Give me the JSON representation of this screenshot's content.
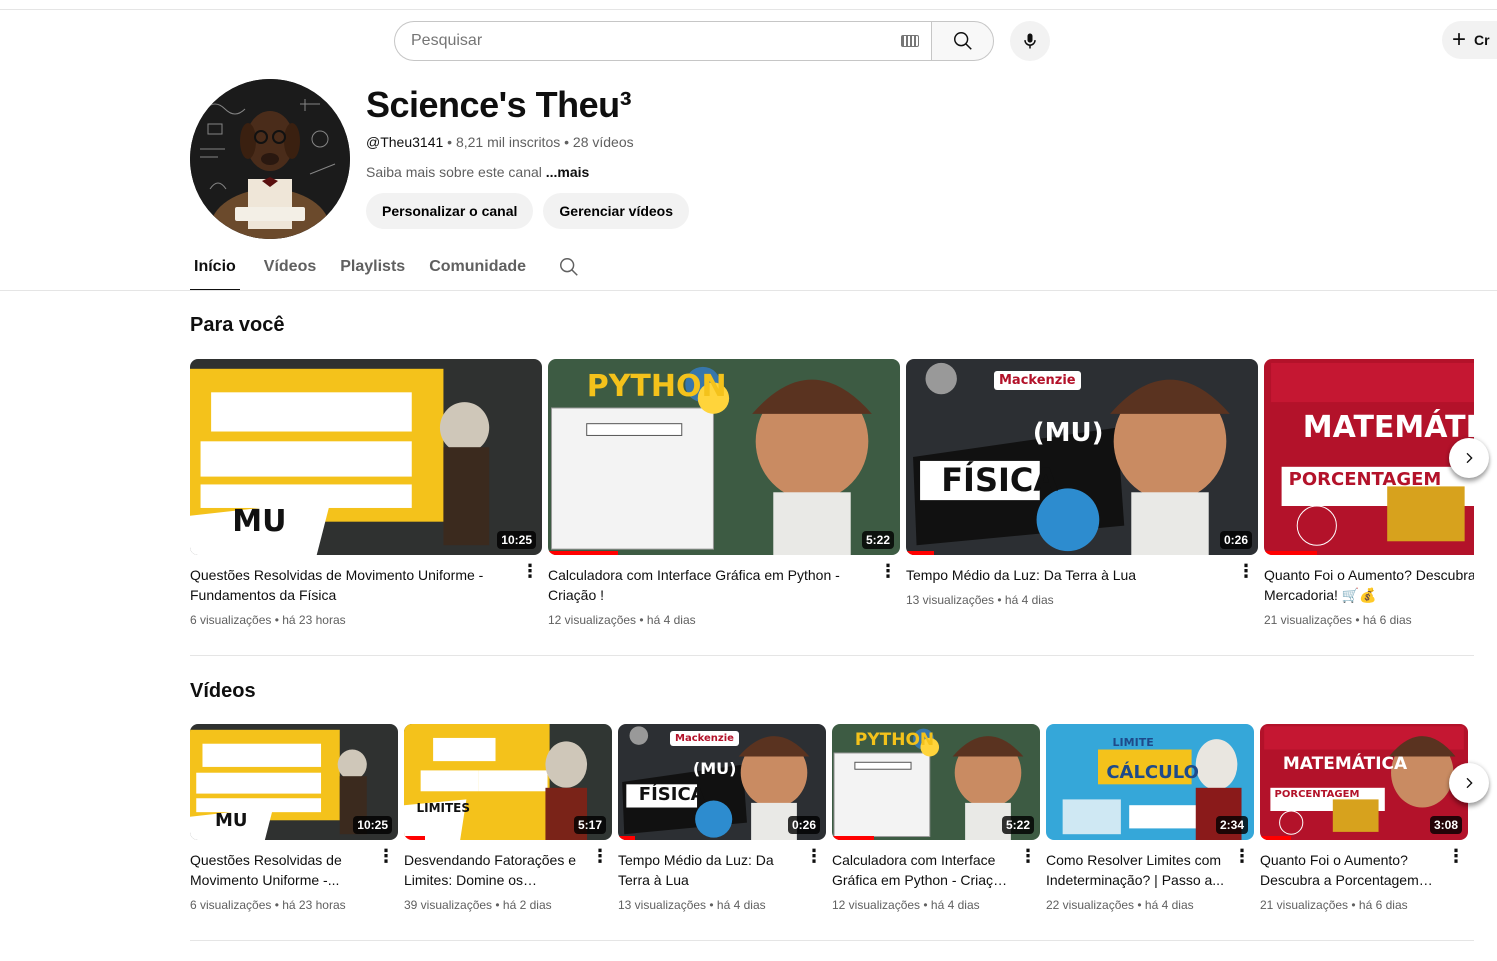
{
  "header": {
    "search_placeholder": "Pesquisar",
    "create_label": "Cr"
  },
  "channel": {
    "name": "Science's Theu³",
    "handle": "@Theu3141",
    "subscribers": "8,21 mil inscritos",
    "video_count": "28 vídeos",
    "about": "Saiba mais sobre este canal",
    "about_more": "...mais",
    "customize_label": "Personalizar o canal",
    "manage_label": "Gerenciar vídeos"
  },
  "tabs": [
    "Início",
    "Vídeos",
    "Playlists",
    "Comunidade"
  ],
  "for_you": {
    "title": "Para você",
    "videos": [
      {
        "title": "Questões Resolvidas de Movimento Uniforme - Fundamentos da Física",
        "meta": "6 visualizações • há 23 horas",
        "duration": "10:25",
        "thumb_text": "MU",
        "progress": 0
      },
      {
        "title": "Calculadora com Interface Gráfica em Python - Criação !",
        "meta": "12 visualizações • há 4 dias",
        "duration": "5:22",
        "thumb_text": "PYTHON",
        "progress": 0.2
      },
      {
        "title": "Tempo Médio da Luz: Da Terra à Lua",
        "meta": "13 visualizações • há 4 dias",
        "duration": "0:26",
        "thumb_text": "FÍSICA",
        "thumb_badge": "Mackenzie",
        "thumb_sub": "(MU)",
        "progress": 0.08
      },
      {
        "title": "Quanto Foi o Aumento? Descubra o Reajuste da Mercadoria! 🛒💰",
        "meta": "21 visualizações • há 6 dias",
        "duration": "",
        "thumb_text": "MATEMÁTICA",
        "thumb_sub": "PORCENTAGEM",
        "progress": 0.15
      }
    ]
  },
  "videos_section": {
    "title": "Vídeos",
    "videos": [
      {
        "title": "Questões Resolvidas de Movimento Uniforme -...",
        "meta": "6 visualizações • há 23 horas",
        "duration": "10:25",
        "thumb_text": "MU",
        "progress": 0
      },
      {
        "title": "Desvendando Fatorações e Limites: Domine os Segredo...",
        "meta": "39 visualizações • há 2 dias",
        "duration": "5:17",
        "thumb_text": "LIMITES",
        "progress": 0.1
      },
      {
        "title": "Tempo Médio da Luz: Da Terra à Lua",
        "meta": "13 visualizações • há 4 dias",
        "duration": "0:26",
        "thumb_text": "FÍSICA",
        "thumb_badge": "Mackenzie",
        "thumb_sub": "(MU)",
        "progress": 0.08
      },
      {
        "title": "Calculadora com Interface Gráfica em Python - Criação !",
        "meta": "12 visualizações • há 4 dias",
        "duration": "5:22",
        "thumb_text": "PYTHON",
        "progress": 0.2
      },
      {
        "title": "Como Resolver Limites com Indeterminação? | Passo a...",
        "meta": "22 visualizações • há 4 dias",
        "duration": "2:34",
        "thumb_text": "CÁLCULO",
        "thumb_sub": "LIMITE",
        "progress": 0
      },
      {
        "title": "Quanto Foi o Aumento? Descubra a Porcentagem d...",
        "meta": "21 visualizações • há 6 dias",
        "duration": "3:08",
        "thumb_text": "MATEMÁTICA",
        "thumb_sub": "PORCENTAGEM",
        "progress": 0.15
      }
    ]
  },
  "colors": {
    "accent_red": "#ff0000",
    "yellow": "#f4c21b",
    "chalk_dark": "#2a3a36",
    "crimson": "#b3122a"
  }
}
